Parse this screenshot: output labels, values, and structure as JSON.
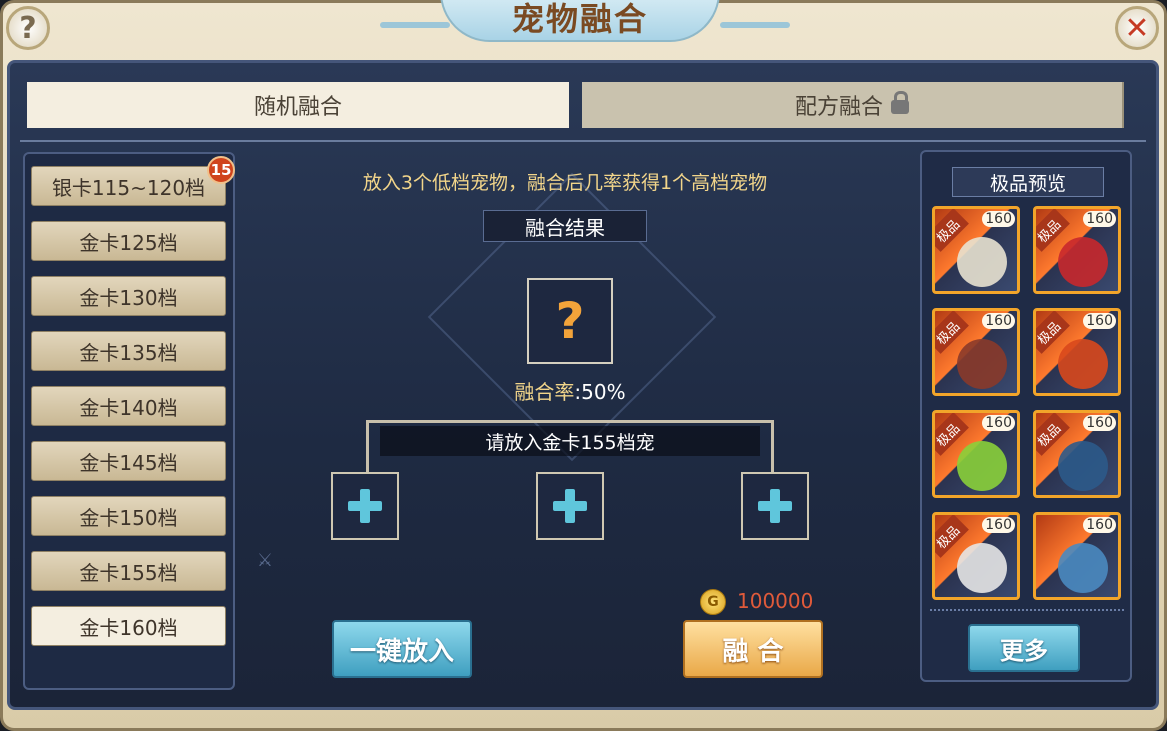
{
  "window": {
    "title": "宠物融合",
    "help_icon": "question-icon",
    "close_icon": "close-x-icon"
  },
  "tabs": [
    {
      "label": "随机融合",
      "active": true
    },
    {
      "label": "配方融合",
      "locked": true
    }
  ],
  "tiers": {
    "badge_count": "15",
    "items": [
      {
        "label": "银卡115~120档"
      },
      {
        "label": "金卡125档"
      },
      {
        "label": "金卡130档"
      },
      {
        "label": "金卡135档"
      },
      {
        "label": "金卡140档"
      },
      {
        "label": "金卡145档"
      },
      {
        "label": "金卡150档"
      },
      {
        "label": "金卡155档"
      },
      {
        "label": "金卡160档",
        "selected": true
      }
    ]
  },
  "fusion": {
    "instruction": "放入3个低档宠物，融合后几率获得1个高档宠物",
    "result_title": "融合结果",
    "result_placeholder": "?",
    "rate_label": "融合率",
    "rate_value": ":50%",
    "slot_prompt": "请放入金卡155档宠",
    "cost": "100000",
    "auto_fill_label": "一键放入",
    "fuse_label": "融 合"
  },
  "preview": {
    "title": "极品预览",
    "quality_label": "极品",
    "level": "160",
    "more_label": "更多",
    "pets": [
      {
        "name": "skull-pet",
        "color": "#e8e2d0"
      },
      {
        "name": "crimson-dragon-pet",
        "color": "#c8282c"
      },
      {
        "name": "armored-pet",
        "color": "#8a3a2a"
      },
      {
        "name": "flame-dragon-pet",
        "color": "#d8481c"
      },
      {
        "name": "green-plant-pet",
        "color": "#8ad03a"
      },
      {
        "name": "dark-blue-pet",
        "color": "#2c5a8a"
      },
      {
        "name": "white-ghost-pet",
        "color": "#e6e6e6"
      },
      {
        "name": "robot-pet",
        "color": "#4a8ac0",
        "quality_hidden": true
      }
    ]
  },
  "colors": {
    "accent_gold": "#f2d58a",
    "cost_red": "#e05a3a",
    "slot_plus": "#5fc6dc"
  }
}
